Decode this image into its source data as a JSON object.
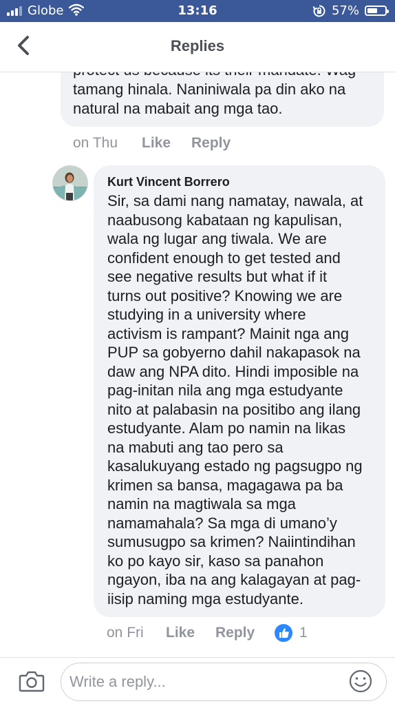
{
  "status_bar": {
    "carrier": "Globe",
    "time": "13:16",
    "battery_text": "57%",
    "battery_level": 0.57
  },
  "header": {
    "title": "Replies",
    "back_icon": "chevron-left-icon"
  },
  "previous_comment": {
    "lines": [
      "protect us because its their mandate. Wag",
      "tamang hinala. Naniniwala pa din ako na",
      "natural na mabait ang mga tao."
    ],
    "time": "on Thu",
    "like_label": "Like",
    "reply_label": "Reply"
  },
  "comment": {
    "author": "Kurt Vincent Borrero",
    "lines": [
      "Sir, sa dami nang namatay, nawala, at",
      "naabusong kabataan ng kapulisan,",
      "wala ng lugar ang tiwala. We are",
      "confident enough to get tested and",
      "see negative results but what if it",
      "turns out positive? Knowing we are",
      "studying in a university where",
      "activism is rampant? Mainit nga ang",
      "PUP sa gobyerno dahil nakapasok na",
      "daw ang NPA dito. Hindi imposible na",
      "pag-initan nila ang mga estudyante",
      "nito at palabasin na positibo ang ilang",
      "estudyante. Alam po namin na likas",
      "na mabuti ang tao pero sa",
      "kasalukuyang estado ng pagsugpo ng",
      "krimen sa bansa, magagawa pa ba",
      "namin na magtiwala sa mga",
      "namamahala? Sa mga di umano’y",
      "sumusugpo sa krimen? Naiintindihan",
      "ko po kayo sir, kaso sa panahon",
      "ngayon, iba na ang kalagayan at pag-",
      "iisip naming mga estudyante."
    ],
    "time": "on Fri",
    "like_label": "Like",
    "reply_label": "Reply",
    "reaction_count": "1",
    "reaction_icon": "thumbs-up-icon"
  },
  "composer": {
    "placeholder": "Write a reply...",
    "camera_icon": "camera-icon",
    "emoji_icon": "smiley-icon"
  },
  "colors": {
    "status_bar": "#3b5998",
    "bubble": "#f1f2f6",
    "meta_text": "#90949c",
    "like_badge": "#2d88ff"
  }
}
